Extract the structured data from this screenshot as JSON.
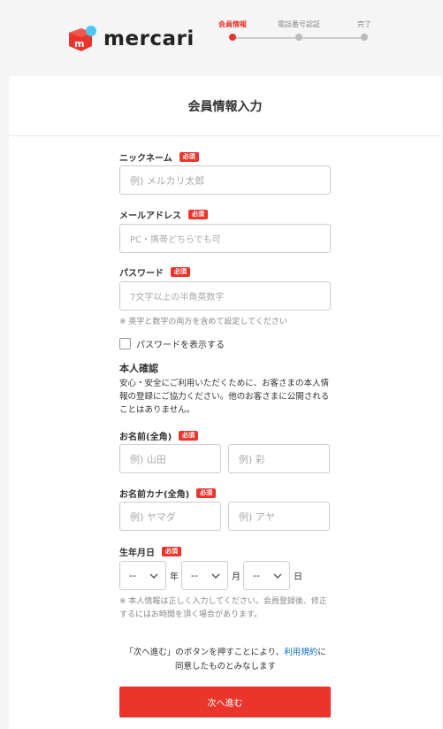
{
  "brand": {
    "name": "mercari",
    "logo_letter": "m",
    "accent": "#ea352d",
    "dot_color": "#4dc7f2"
  },
  "steps": [
    {
      "label": "会員情報",
      "active": true
    },
    {
      "label": "電話番号認証",
      "active": false
    },
    {
      "label": "完了",
      "active": false
    }
  ],
  "form": {
    "title": "会員情報入力",
    "required_badge": "必須",
    "nickname": {
      "label": "ニックネーム",
      "placeholder": "例) メルカリ太郎"
    },
    "email": {
      "label": "メールアドレス",
      "placeholder": "PC・携帯どちらでも可"
    },
    "password": {
      "label": "パスワード",
      "placeholder": "7文字以上の半角英数字",
      "note": "※ 英字と数字の両方を含めて設定してください",
      "show_label": "パスワードを表示する"
    },
    "identity": {
      "title": "本人確認",
      "description": "安心・安全にご利用いただくために、お客さまの本人情報の登録にご協力ください。他のお客さまに公開されることはありません。"
    },
    "name": {
      "label": "お名前(全角)",
      "last_placeholder": "例) 山田",
      "first_placeholder": "例) 彩"
    },
    "name_kana": {
      "label": "お名前カナ(全角)",
      "last_placeholder": "例) ヤマダ",
      "first_placeholder": "例) アヤ"
    },
    "birthday": {
      "label": "生年月日",
      "year_value": "--",
      "month_value": "--",
      "day_value": "--",
      "year_unit": "年",
      "month_unit": "月",
      "day_unit": "日",
      "note": "※ 本人情報は正しく入力してください。会員登録後、修正するにはお時間を頂く場合があります。"
    },
    "terms": {
      "line1_pre": "「次へ進む」のボタンを押すことにより、",
      "link": "利用規約",
      "line1_post": "に",
      "line2": "同意したものとみなします"
    },
    "next_button": "次へ進む"
  }
}
